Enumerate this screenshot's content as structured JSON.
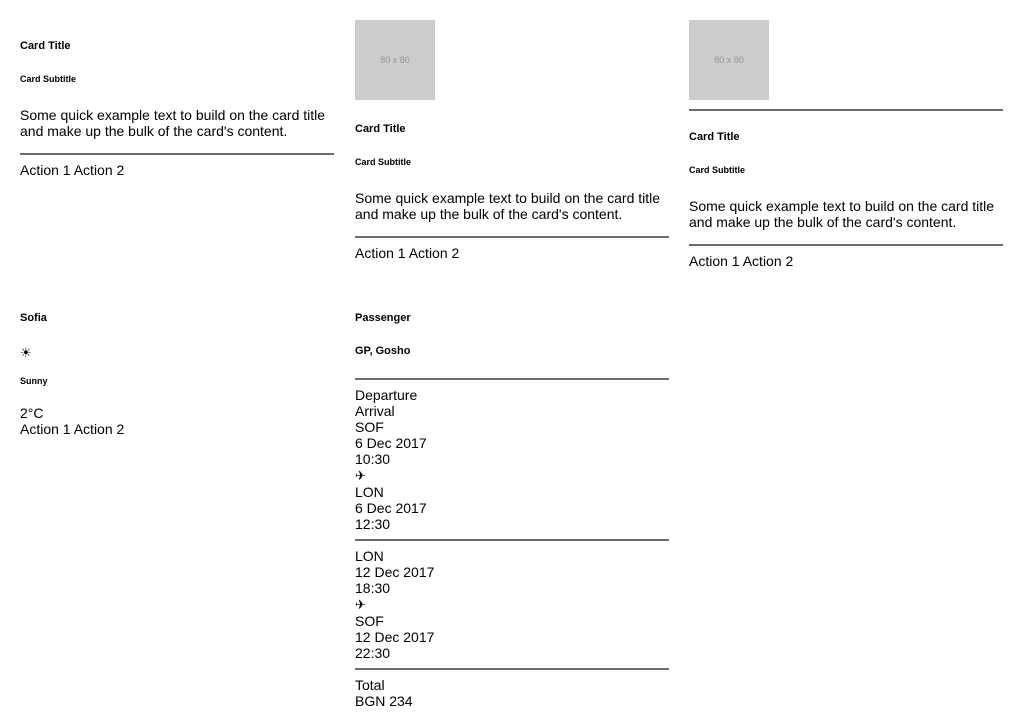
{
  "cards": {
    "basic": {
      "title": "Card Title",
      "subtitle": "Card Subtitle",
      "text": "Some quick example text to build on the card title and make up the bulk of the card's content.",
      "action1": "Action 1",
      "action2": "Action 2"
    },
    "media_top": {
      "image_label": "80 x 80",
      "title": "Card Title",
      "subtitle": "Card Subtitle",
      "text": "Some quick example text to build on the card title and make up the bulk of the card's content.",
      "action1": "Action 1",
      "action2": "Action 2"
    },
    "media_divided": {
      "image_label": "80 x 80",
      "title": "Card Title",
      "subtitle": "Card Subtitle",
      "text": "Some quick example text to build on the card title and make up the bulk of the card's content.",
      "action1": "Action 1",
      "action2": "Action 2"
    },
    "weather": {
      "city": "Sofia",
      "icon_glyph": "☀",
      "icon_name": "sun-icon",
      "condition": "Sunny",
      "temperature": "2°C",
      "action1": "Action 1",
      "action2": "Action 2"
    },
    "flight": {
      "header_title": "Passenger",
      "passenger_name": "GP, Gosho",
      "departure_label": "Departure",
      "arrival_label": "Arrival",
      "outbound": {
        "from_code": "SOF",
        "from_date": "6 Dec 2017",
        "from_time": "10:30",
        "plane_glyph": "✈",
        "to_code": "LON",
        "to_date": "6 Dec 2017",
        "to_time": "12:30"
      },
      "return": {
        "from_code": "LON",
        "from_date": "12 Dec 2017",
        "from_time": "18:30",
        "plane_glyph": "✈",
        "to_code": "SOF",
        "to_date": "12 Dec 2017",
        "to_time": "22:30"
      },
      "total_label": "Total",
      "total_value": "BGN 234"
    }
  }
}
